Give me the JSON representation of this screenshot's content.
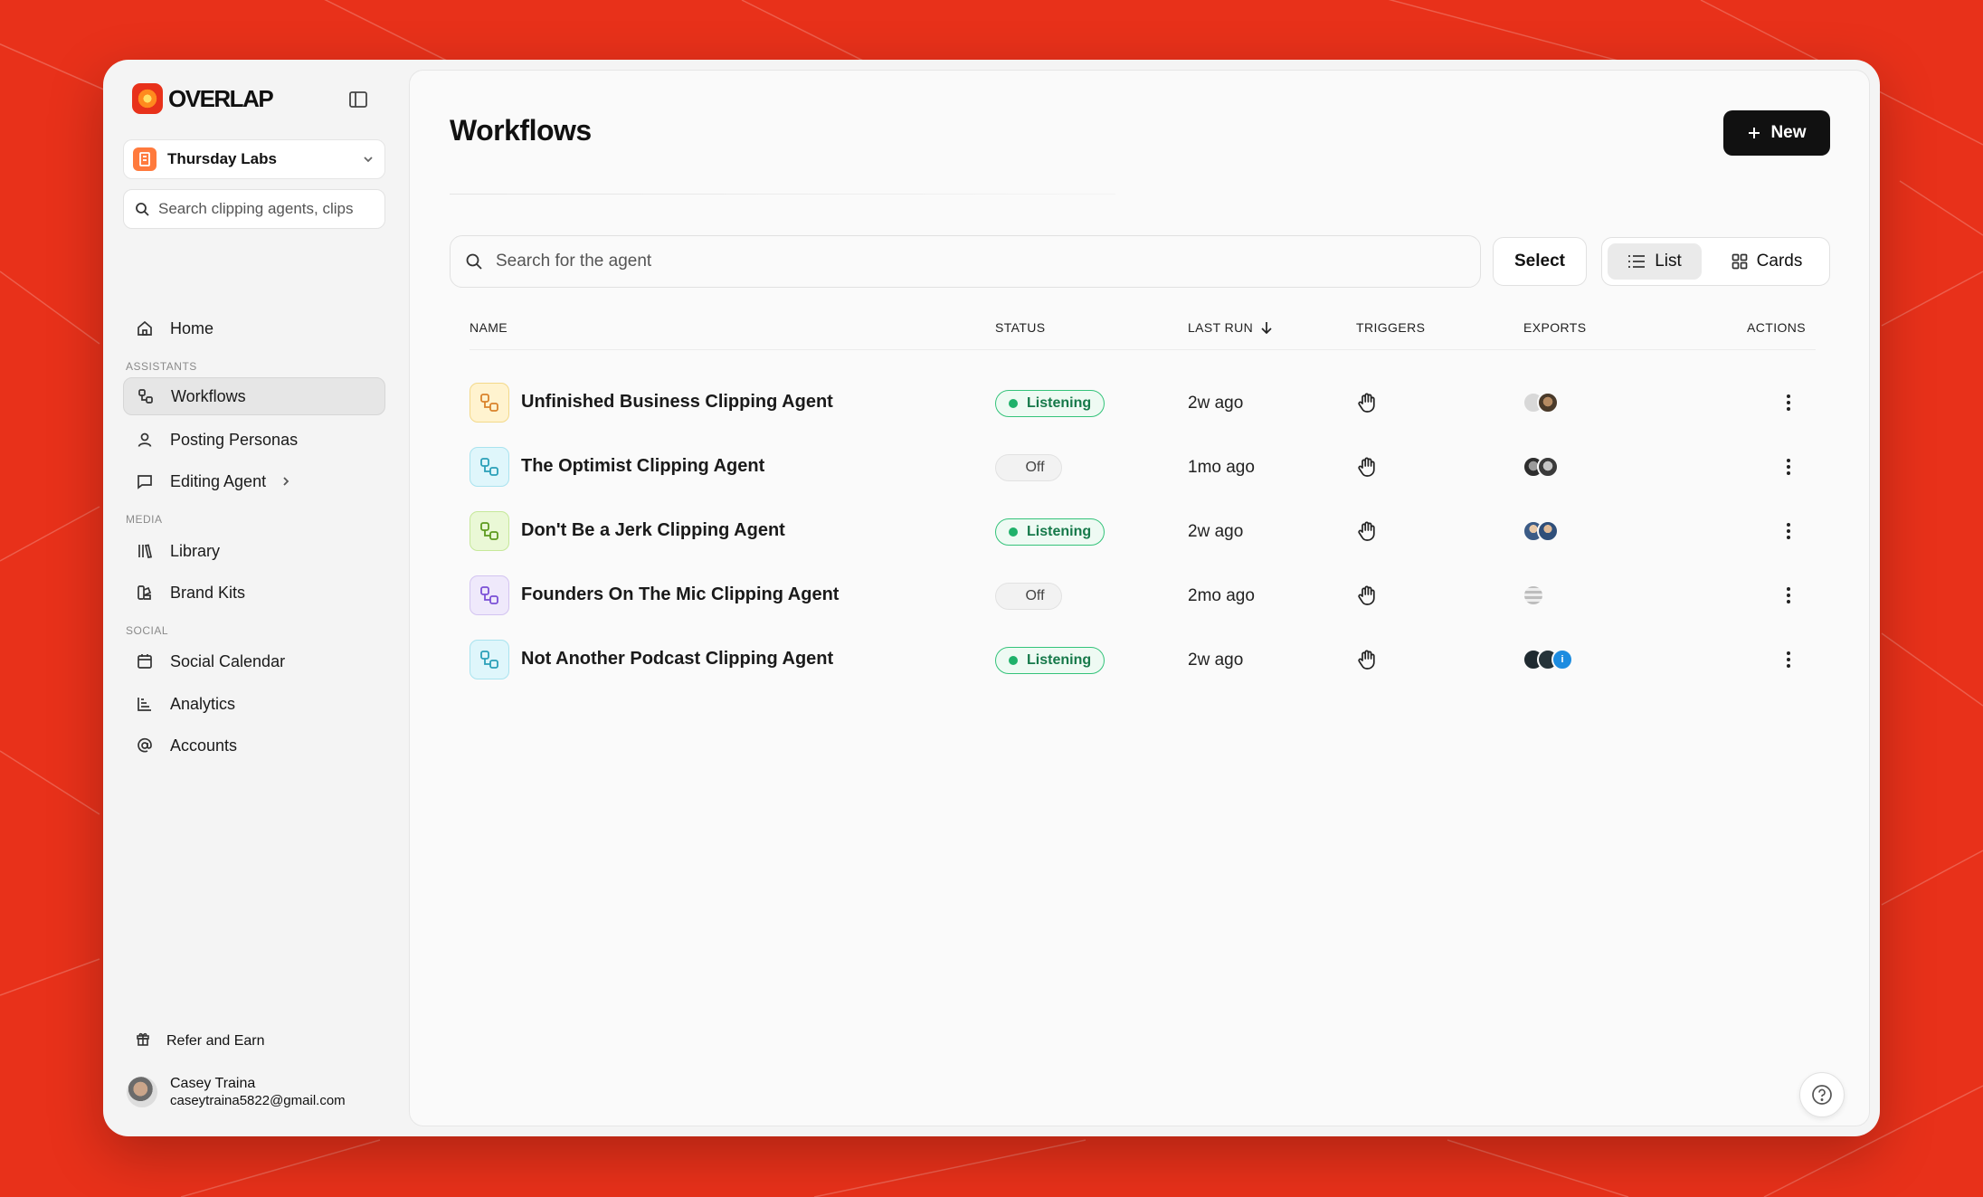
{
  "brand": {
    "name": "OVERLAP",
    "accent": "#e8311a"
  },
  "sidebar": {
    "workspace": "Thursday Labs",
    "search_placeholder": "Search clipping agents, clips",
    "home": "Home",
    "sections": {
      "assistants": "ASSISTANTS",
      "media": "MEDIA",
      "social": "SOCIAL"
    },
    "items": {
      "workflows": "Workflows",
      "posting_personas": "Posting Personas",
      "editing_agent": "Editing Agent",
      "library": "Library",
      "brand_kits": "Brand Kits",
      "social_calendar": "Social Calendar",
      "analytics": "Analytics",
      "accounts": "Accounts"
    },
    "refer": "Refer and Earn",
    "user": {
      "name": "Casey Traina",
      "email": "caseytraina5822@gmail.com"
    }
  },
  "main": {
    "title": "Workflows",
    "new_label": "New",
    "search_placeholder": "Search for the agent",
    "select_label": "Select",
    "view": {
      "list": "List",
      "cards": "Cards",
      "selected": "List"
    },
    "columns": {
      "name": "NAME",
      "status": "STATUS",
      "last_run": "LAST RUN",
      "triggers": "TRIGGERS",
      "exports": "EXPORTS",
      "actions": "ACTIONS"
    },
    "rows": [
      {
        "name": "Unfinished Business Clipping Agent",
        "status": "Listening",
        "last_run": "2w ago",
        "trigger_icon": "hand-icon",
        "exports": 2
      },
      {
        "name": "The Optimist Clipping Agent",
        "status": "Off",
        "last_run": "1mo ago",
        "trigger_icon": "hand-icon",
        "exports": 2
      },
      {
        "name": "Don't Be a Jerk Clipping Agent",
        "status": "Listening",
        "last_run": "2w ago",
        "trigger_icon": "hand-icon",
        "exports": 2
      },
      {
        "name": "Founders On The Mic Clipping Agent",
        "status": "Off",
        "last_run": "2mo ago",
        "trigger_icon": "hand-icon",
        "exports": 1
      },
      {
        "name": "Not Another Podcast Clipping Agent",
        "status": "Listening",
        "last_run": "2w ago",
        "trigger_icon": "hand-icon",
        "exports": 3
      }
    ],
    "export_badge": "i"
  },
  "colors": {
    "listening_green": "#1fb16a",
    "icon_yellow": "#fff3cf",
    "icon_cyan": "#dff6fb",
    "icon_lime": "#eaf8d6",
    "icon_purple": "#efe9fb"
  }
}
